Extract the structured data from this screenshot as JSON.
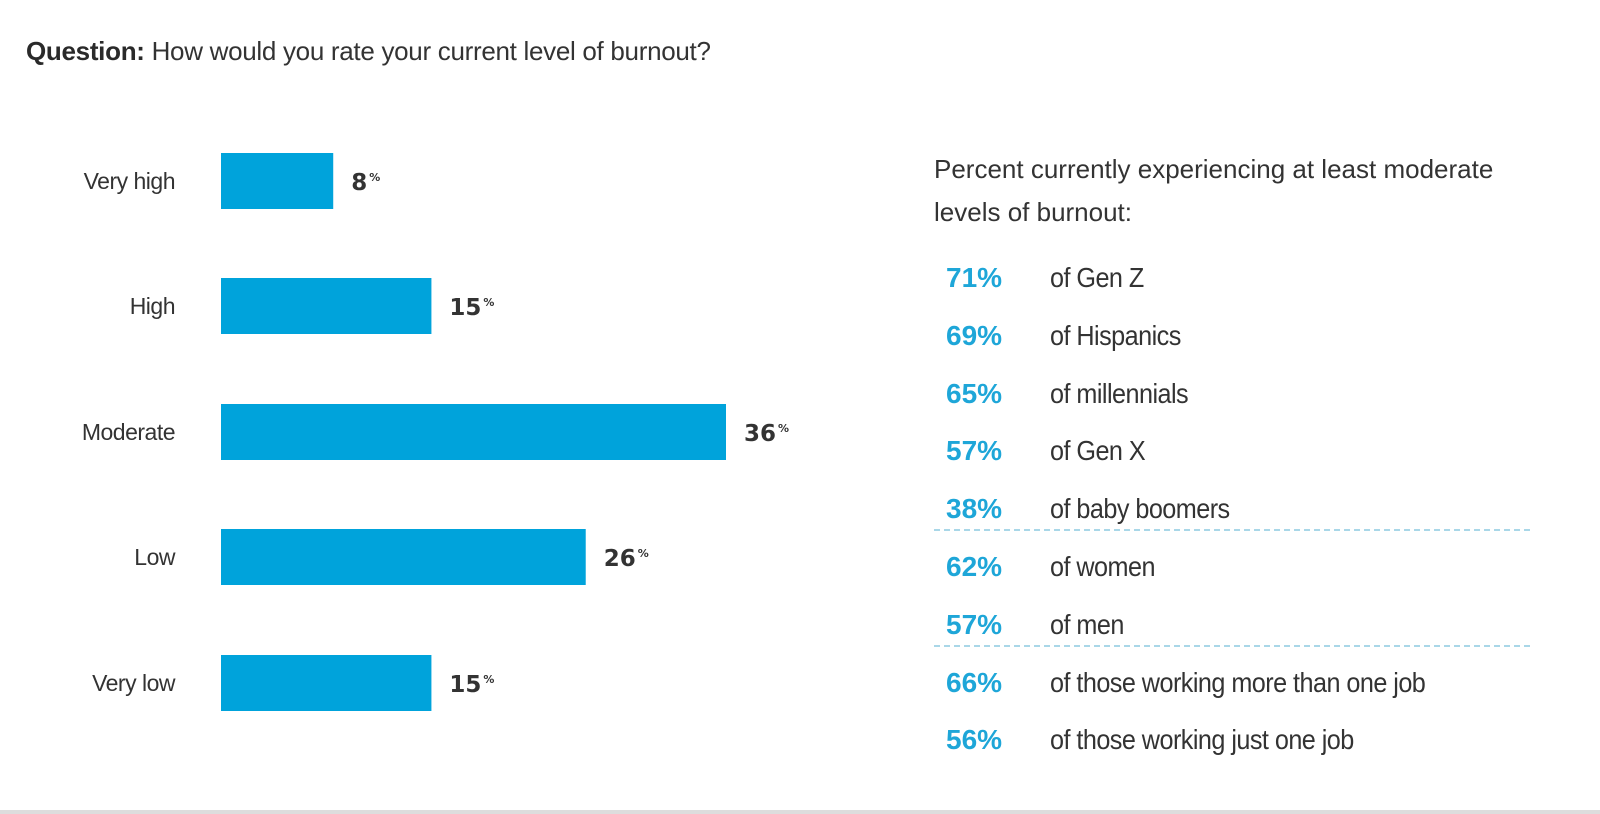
{
  "question": {
    "label": "Question:",
    "text": "How would you rate your current level of burnout?"
  },
  "colors": {
    "bar": "#00a3db",
    "accent_text": "#1ea6d8"
  },
  "chart_data": {
    "type": "bar",
    "orientation": "horizontal",
    "categories": [
      "Very high",
      "High",
      "Moderate",
      "Low",
      "Very low"
    ],
    "values": [
      8,
      15,
      36,
      26,
      15
    ],
    "value_labels": [
      "8",
      "15",
      "36",
      "26",
      "15"
    ],
    "unit": "%",
    "xlim": [
      0,
      36
    ],
    "grid": false
  },
  "side_panel": {
    "title": "Percent currently experiencing at least moderate levels of burnout:",
    "groups": [
      [
        {
          "value": "71%",
          "label": "of Gen Z"
        },
        {
          "value": "69%",
          "label": "of Hispanics"
        },
        {
          "value": "65%",
          "label": "of millennials"
        },
        {
          "value": "57%",
          "label": "of Gen X"
        },
        {
          "value": "38%",
          "label": "of baby boomers"
        }
      ],
      [
        {
          "value": "62%",
          "label": "of women"
        },
        {
          "value": "57%",
          "label": "of men"
        }
      ],
      [
        {
          "value": "66%",
          "label": "of those working more than one job"
        },
        {
          "value": "56%",
          "label": "of those working just one job"
        }
      ]
    ]
  }
}
